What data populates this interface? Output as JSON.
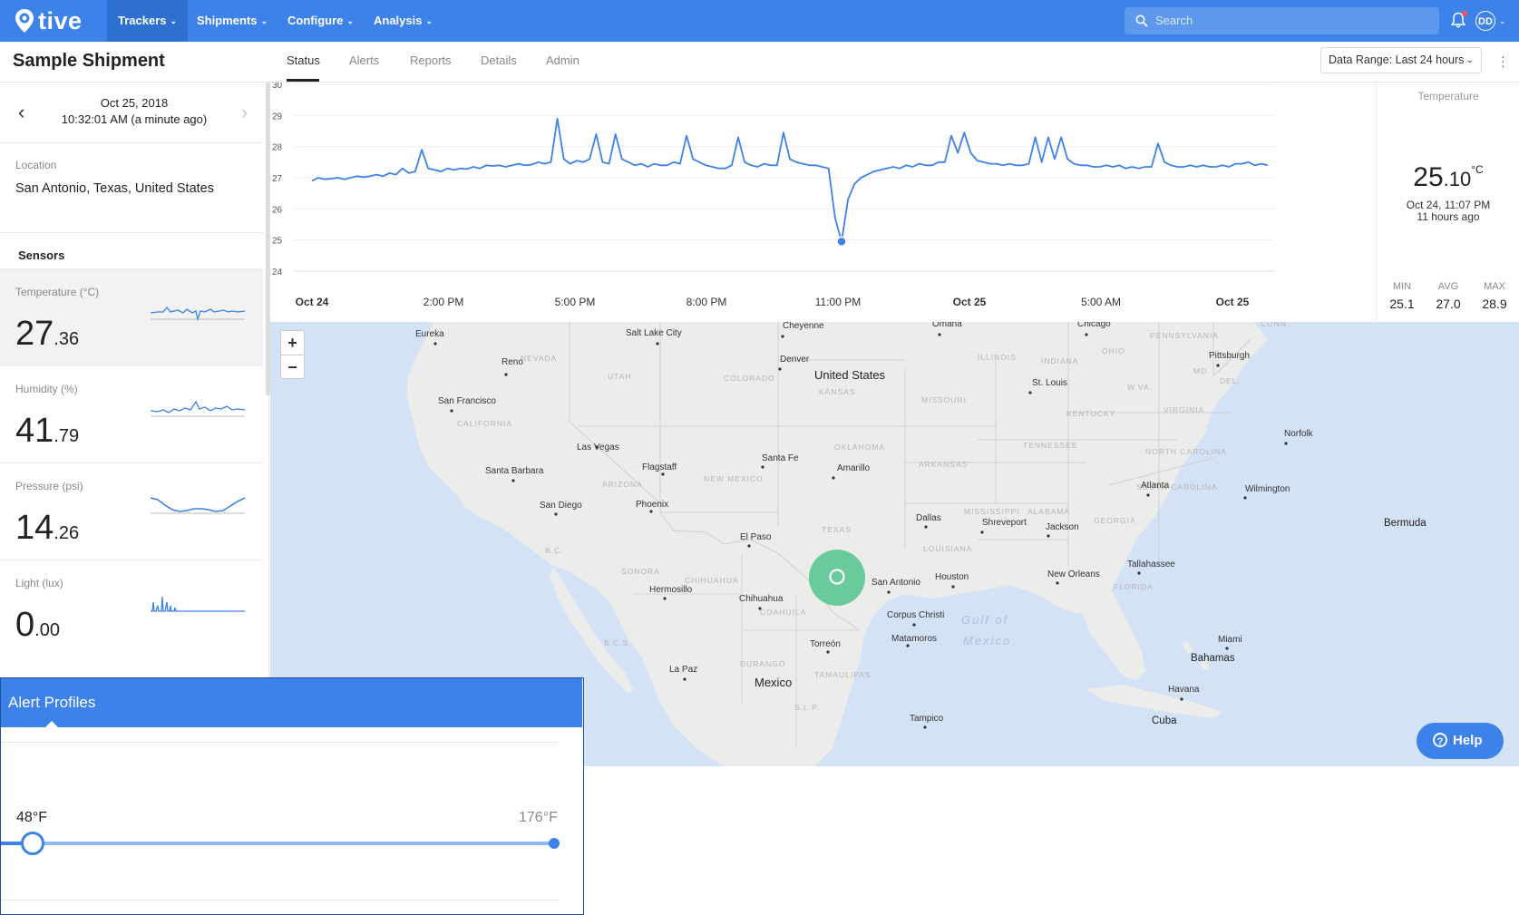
{
  "app": {
    "name": "tive"
  },
  "nav": {
    "items": [
      {
        "label": "Trackers"
      },
      {
        "label": "Shipments"
      },
      {
        "label": "Configure"
      },
      {
        "label": "Analysis"
      }
    ],
    "search_placeholder": "Search",
    "avatar_initials": "DD"
  },
  "header": {
    "title": "Sample Shipment",
    "tabs": [
      {
        "label": "Status"
      },
      {
        "label": "Alerts"
      },
      {
        "label": "Reports"
      },
      {
        "label": "Details"
      },
      {
        "label": "Admin"
      }
    ],
    "data_range": "Data Range: Last 24 hours"
  },
  "sidebar": {
    "date": "Oct 25, 2018",
    "time": "10:32:01 AM (a minute ago)",
    "location_label": "Location",
    "location_value": "San Antonio, Texas, United States",
    "sensors_title": "Sensors",
    "sensors": [
      {
        "label": "Temperature (°C)",
        "int": "27",
        "dec": ".36"
      },
      {
        "label": "Humidity (%)",
        "int": "41",
        "dec": ".79"
      },
      {
        "label": "Pressure (psi)",
        "int": "14",
        "dec": ".26"
      },
      {
        "label": "Light (lux)",
        "int": "0",
        "dec": ".00"
      }
    ]
  },
  "chart_data": {
    "type": "line",
    "title": "",
    "xlabel": "",
    "ylabel": "",
    "ylim": [
      24,
      30
    ],
    "y_ticks": [
      "30",
      "29",
      "28",
      "27",
      "26",
      "25",
      "24"
    ],
    "x_ticks": [
      "Oct 24",
      "2:00 PM",
      "5:00 PM",
      "8:00 PM",
      "11:00 PM",
      "Oct 25",
      "5:00 AM",
      "Oct 25"
    ],
    "x_tick_bold": [
      true,
      false,
      false,
      false,
      false,
      true,
      false,
      true
    ],
    "grid": true,
    "series": [
      {
        "values": [
          26.9,
          27.0,
          26.95,
          26.97,
          27.0,
          26.95,
          27.0,
          27.05,
          27.02,
          27.05,
          27.1,
          27.05,
          27.15,
          27.1,
          27.3,
          27.15,
          27.2,
          27.9,
          27.3,
          27.25,
          27.2,
          27.3,
          27.25,
          27.3,
          27.28,
          27.35,
          27.3,
          27.4,
          27.38,
          27.4,
          27.35,
          27.4,
          27.45,
          27.4,
          27.42,
          27.5,
          27.45,
          27.5,
          28.9,
          27.6,
          27.45,
          27.55,
          27.5,
          27.6,
          28.4,
          27.5,
          27.45,
          28.4,
          27.6,
          27.5,
          27.4,
          27.45,
          27.35,
          27.45,
          27.4,
          27.4,
          27.5,
          27.45,
          28.35,
          27.6,
          27.5,
          27.4,
          27.35,
          27.3,
          27.3,
          27.4,
          28.3,
          27.5,
          27.4,
          27.35,
          27.45,
          27.4,
          27.4,
          28.45,
          27.6,
          27.5,
          27.45,
          27.4,
          27.4,
          27.35,
          27.3,
          25.7,
          24.95,
          26.3,
          26.8,
          27.0,
          27.1,
          27.2,
          27.25,
          27.3,
          27.35,
          27.3,
          27.4,
          27.35,
          27.45,
          27.4,
          27.4,
          27.5,
          27.5,
          28.35,
          27.8,
          28.45,
          27.8,
          27.55,
          27.5,
          27.45,
          27.45,
          27.4,
          27.45,
          27.4,
          27.4,
          27.45,
          28.3,
          27.5,
          28.3,
          27.6,
          28.3,
          27.6,
          27.45,
          27.4,
          27.4,
          27.35,
          27.35,
          27.4,
          27.35,
          27.4,
          27.3,
          27.35,
          27.3,
          27.35,
          27.35,
          28.1,
          27.5,
          27.4,
          27.35,
          27.35,
          27.4,
          27.35,
          27.4,
          27.35,
          27.35,
          27.4,
          27.35,
          27.45,
          27.45,
          27.5,
          27.4,
          27.45,
          27.4
        ],
        "highlight_min": {
          "value": 24.95
        }
      }
    ]
  },
  "temperature_panel": {
    "title": "Temperature",
    "int": "25",
    "dec": ".10",
    "unit": "°C",
    "time": "Oct 24, 11:07 PM",
    "ago": "11 hours ago",
    "stats": [
      {
        "label": "MIN",
        "value": "25.1"
      },
      {
        "label": "AVG",
        "value": "27.0"
      },
      {
        "label": "MAX",
        "value": "28.9"
      }
    ]
  },
  "map": {
    "zoom_in": "+",
    "zoom_out": "−",
    "country_labels": [
      "United States",
      "Mexico",
      "Cuba",
      "Bahamas",
      "Bermuda"
    ],
    "cities": [
      "Eureka",
      "Salt Lake City",
      "Cheyenne",
      "Omaha",
      "Chicago",
      "Reno",
      "Denver",
      "Pittsburgh",
      "St. Louis",
      "San Francisco",
      "Norfolk",
      "Las Vegas",
      "Santa Fe",
      "Flagstaff",
      "Amarillo",
      "Santa Barbara",
      "Atlanta",
      "Wilmington",
      "San Diego",
      "Phoenix",
      "Dallas",
      "Shreveport",
      "Jackson",
      "El Paso",
      "Tallahassee",
      "Hermosillo",
      "Houston",
      "New Orleans",
      "San Antonio",
      "Chihuahua",
      "Corpus Christi",
      "Matamoros",
      "Torreón",
      "Miami",
      "La Paz",
      "Havana",
      "Tampico"
    ],
    "states": [
      "NEVADA",
      "UTAH",
      "COLORADO",
      "KANSAS",
      "MISSOURI",
      "ILLINOIS",
      "INDIANA",
      "OHIO",
      "PENNSYLVANIA",
      "CALIFORNIA",
      "KENTUCKY",
      "VIRGINIA",
      "W.VA.",
      "MD.",
      "DEL.",
      "ARIZONA",
      "NEW MEXICO",
      "OKLAHOMA",
      "TENNESSEE",
      "NORTH CAROLINA",
      "ARKANSAS",
      "SOUTH CAROLINA",
      "MISSISSIPPI",
      "ALABAMA",
      "GEORGIA",
      "TEXAS",
      "LOUISIANA",
      "FLORIDA",
      "SONORA",
      "CHIHUAHUA",
      "COAHUILA",
      "B.C.",
      "B.C.S.",
      "DURANGO",
      "TAMAULIPAS",
      "S.L.P.",
      "CONN."
    ],
    "water_labels": [
      "Gulf of Mexico"
    ],
    "help_label": "Help"
  },
  "alert_profiles": {
    "title": "Alert Profiles",
    "min_label": "48°F",
    "max_label": "176°F",
    "slider_min_value": 48,
    "slider_max_value": 176
  },
  "colors": {
    "brand": "#3d82e8",
    "line": "#3d82e8",
    "marker_green": "#52c48e"
  }
}
